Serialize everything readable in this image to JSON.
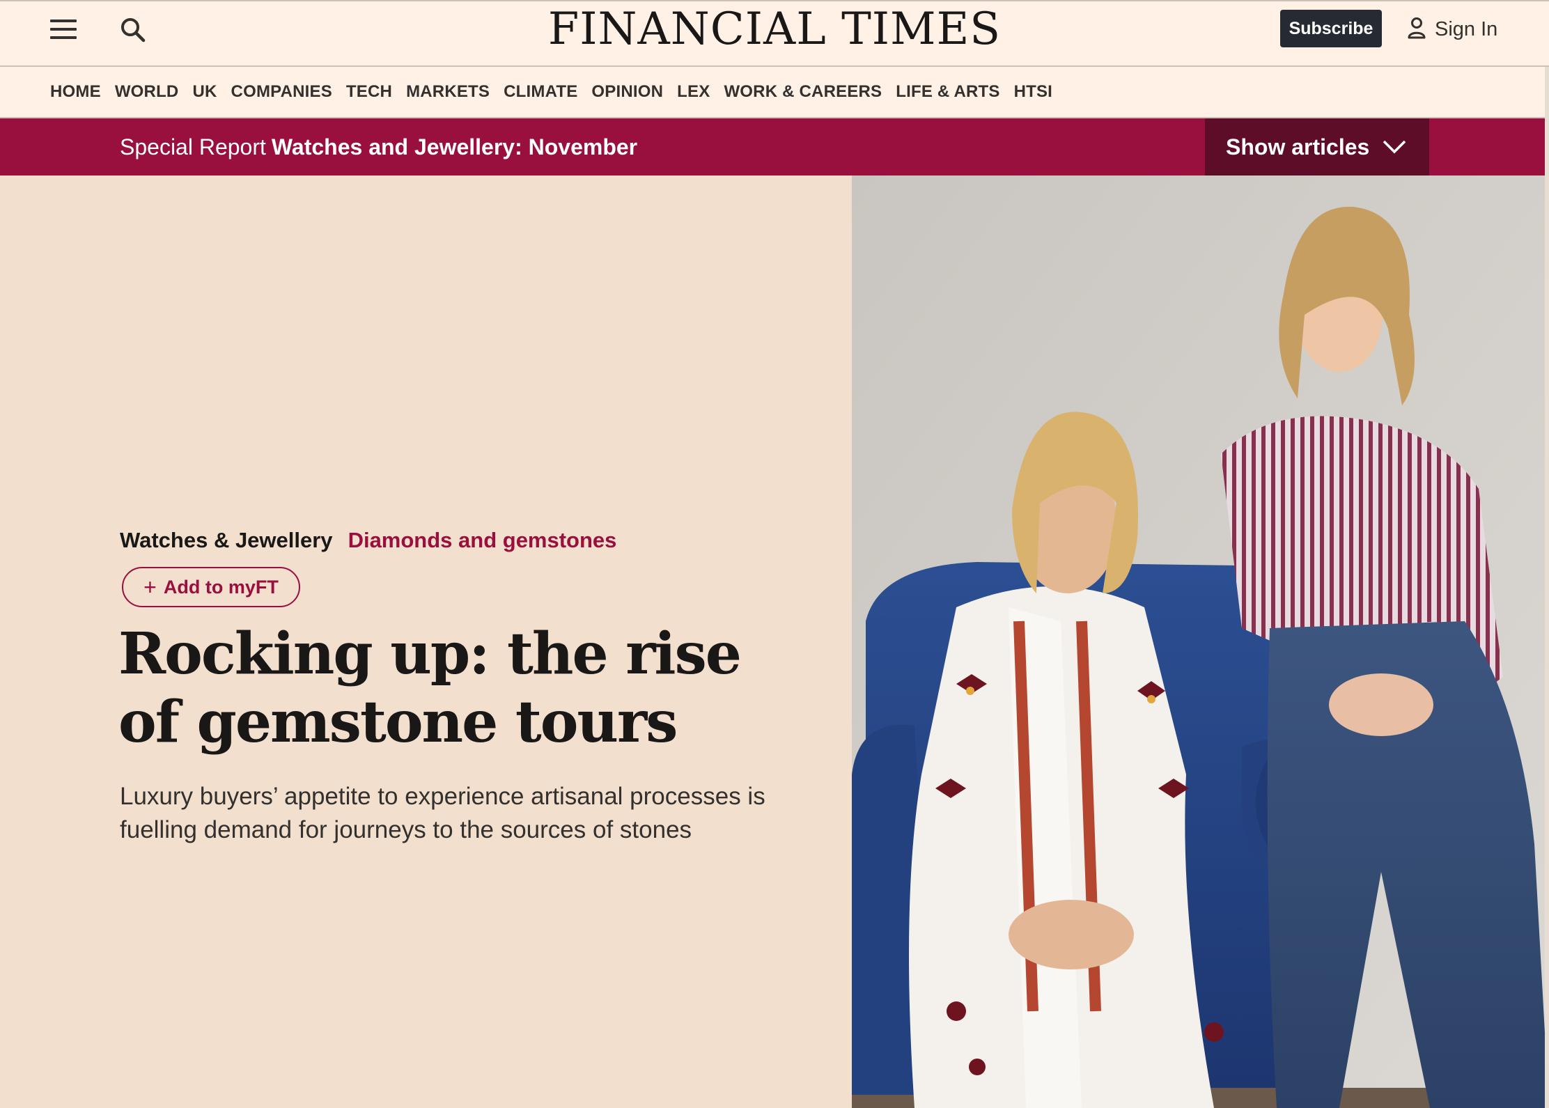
{
  "header": {
    "logo": "FINANCIAL TIMES",
    "subscribe_label": "Subscribe",
    "signin_label": "Sign In",
    "icons": [
      "menu-icon",
      "search-icon",
      "user-icon"
    ]
  },
  "nav": {
    "items": [
      "HOME",
      "WORLD",
      "UK",
      "COMPANIES",
      "TECH",
      "MARKETS",
      "CLIMATE",
      "OPINION",
      "LEX",
      "WORK & CAREERS",
      "LIFE & ARTS",
      "HTSI"
    ]
  },
  "special_report": {
    "kicker": "Special Report",
    "title": "Watches and Jewellery: November",
    "toggle_label": "Show articles",
    "toggle_icon": "chevron-down-icon"
  },
  "article": {
    "primary_tag": "Watches & Jewellery",
    "secondary_tag": "Diamonds and gemstones",
    "myft_label": "Add to myFT",
    "headline": "Rocking up: the rise of gemstone tours",
    "standfirst": "Luxury buyers’ appetite to experience artisanal processes is fuelling demand for journeys to the sources of stones"
  },
  "colors": {
    "paper": "#fff1e5",
    "wheat": "#f2dfce",
    "claret": "#990f3d",
    "claret_dark": "#5d0d28",
    "slate": "#262a33"
  }
}
